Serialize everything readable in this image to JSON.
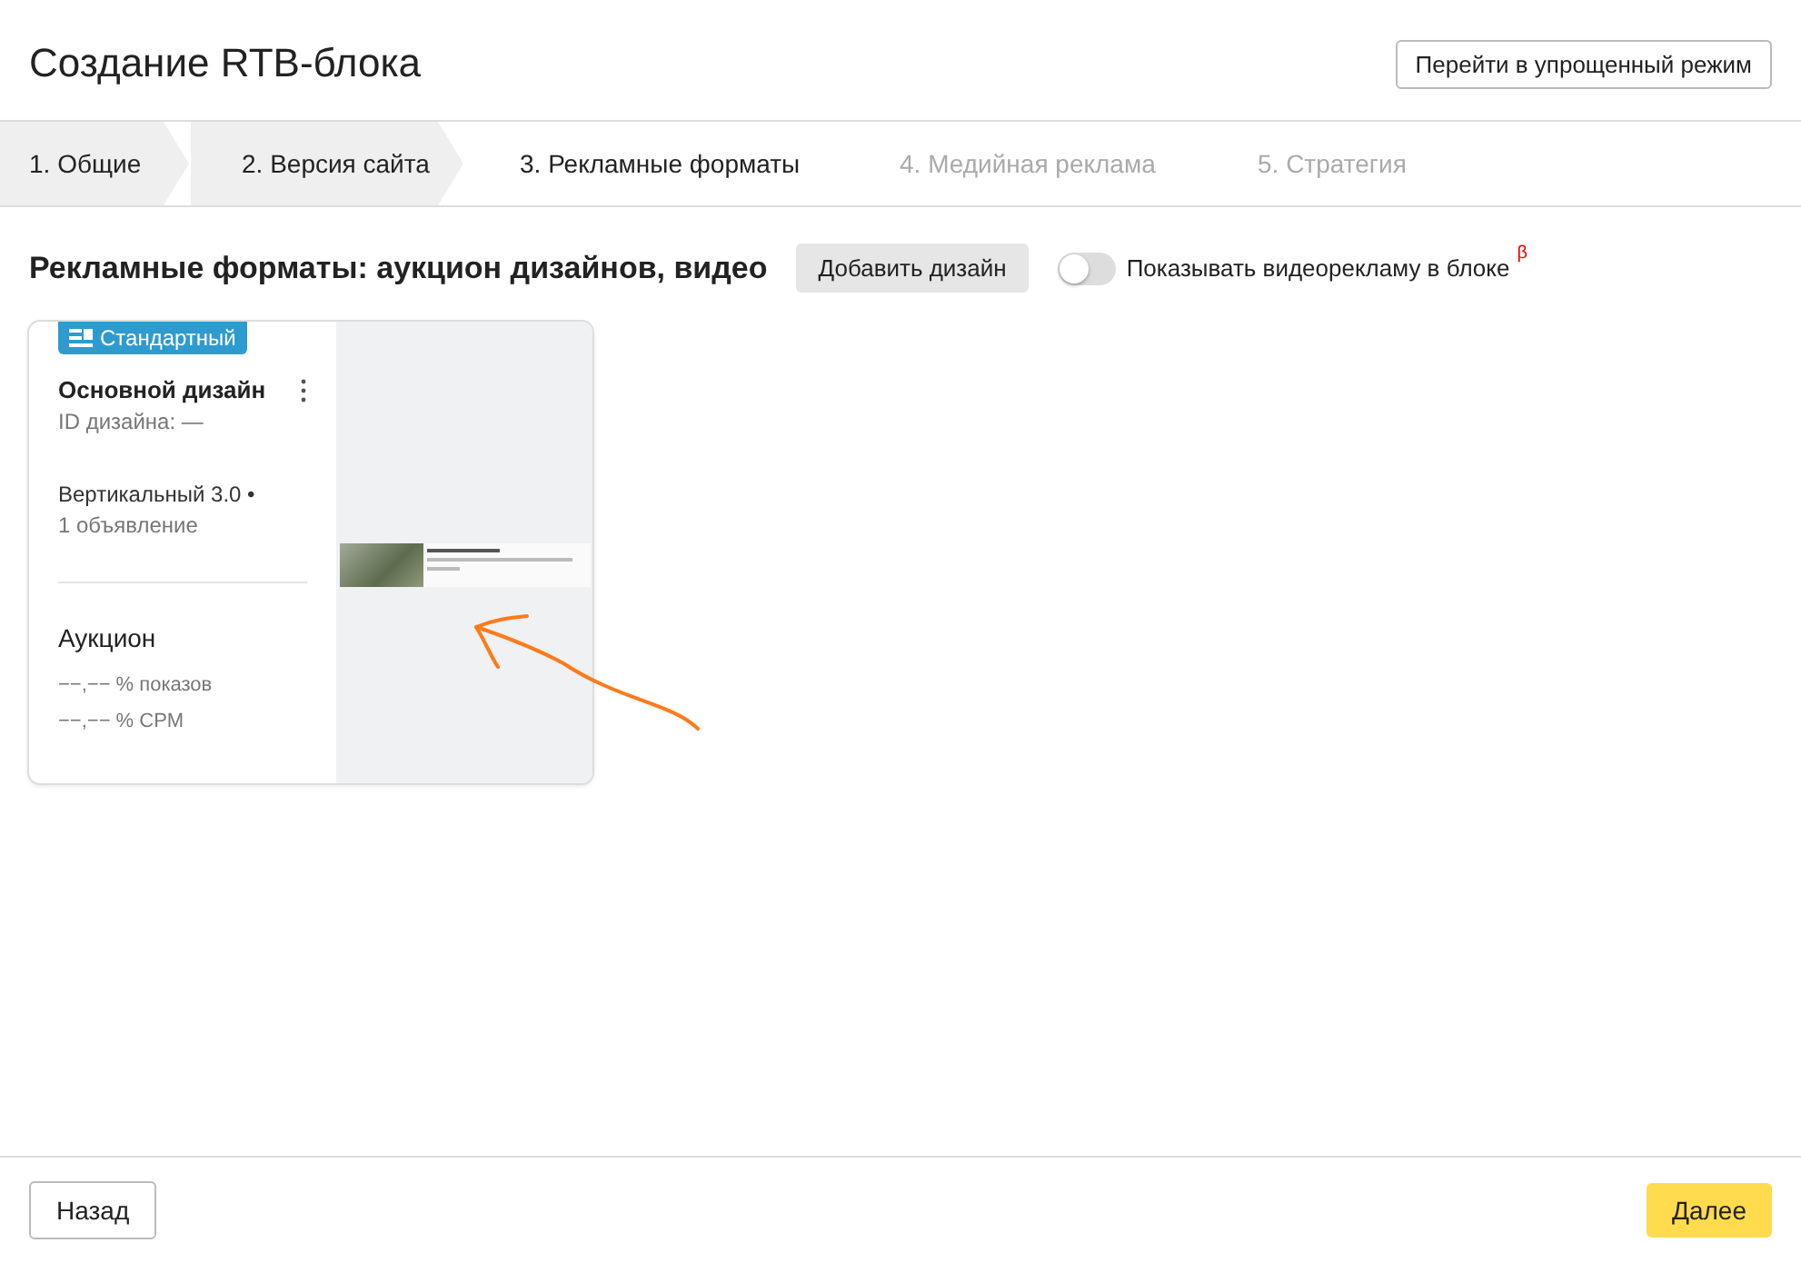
{
  "header": {
    "title": "Создание RTB-блока",
    "simple_mode_button": "Перейти в упрощенный режим"
  },
  "steps": [
    {
      "label": "1. Общие",
      "completed": true,
      "disabled": false
    },
    {
      "label": "2. Версия сайта",
      "completed": true,
      "disabled": false
    },
    {
      "label": "3. Рекламные форматы",
      "completed": false,
      "disabled": false
    },
    {
      "label": "4. Медийная реклама",
      "completed": false,
      "disabled": true
    },
    {
      "label": "5. Стратегия",
      "completed": false,
      "disabled": true
    }
  ],
  "section": {
    "title": "Рекламные форматы: аукцион дизайнов, видео",
    "add_button": "Добавить дизайн",
    "video_toggle": {
      "label": "Показывать видеорекламу в блоке",
      "beta": "β",
      "on": false
    }
  },
  "designs": [
    {
      "badge": "Стандартный",
      "name": "Основной дизайн",
      "id_line": "ID дизайна: —",
      "template": "Вертикальный 3.0 •",
      "ads_count": "1 объявление",
      "mode": "Аукцион",
      "stats": [
        "−−,−− % показов",
        "−−,−− % CPM"
      ]
    }
  ],
  "footer": {
    "back_button": "Назад",
    "next_button": "Далее"
  }
}
